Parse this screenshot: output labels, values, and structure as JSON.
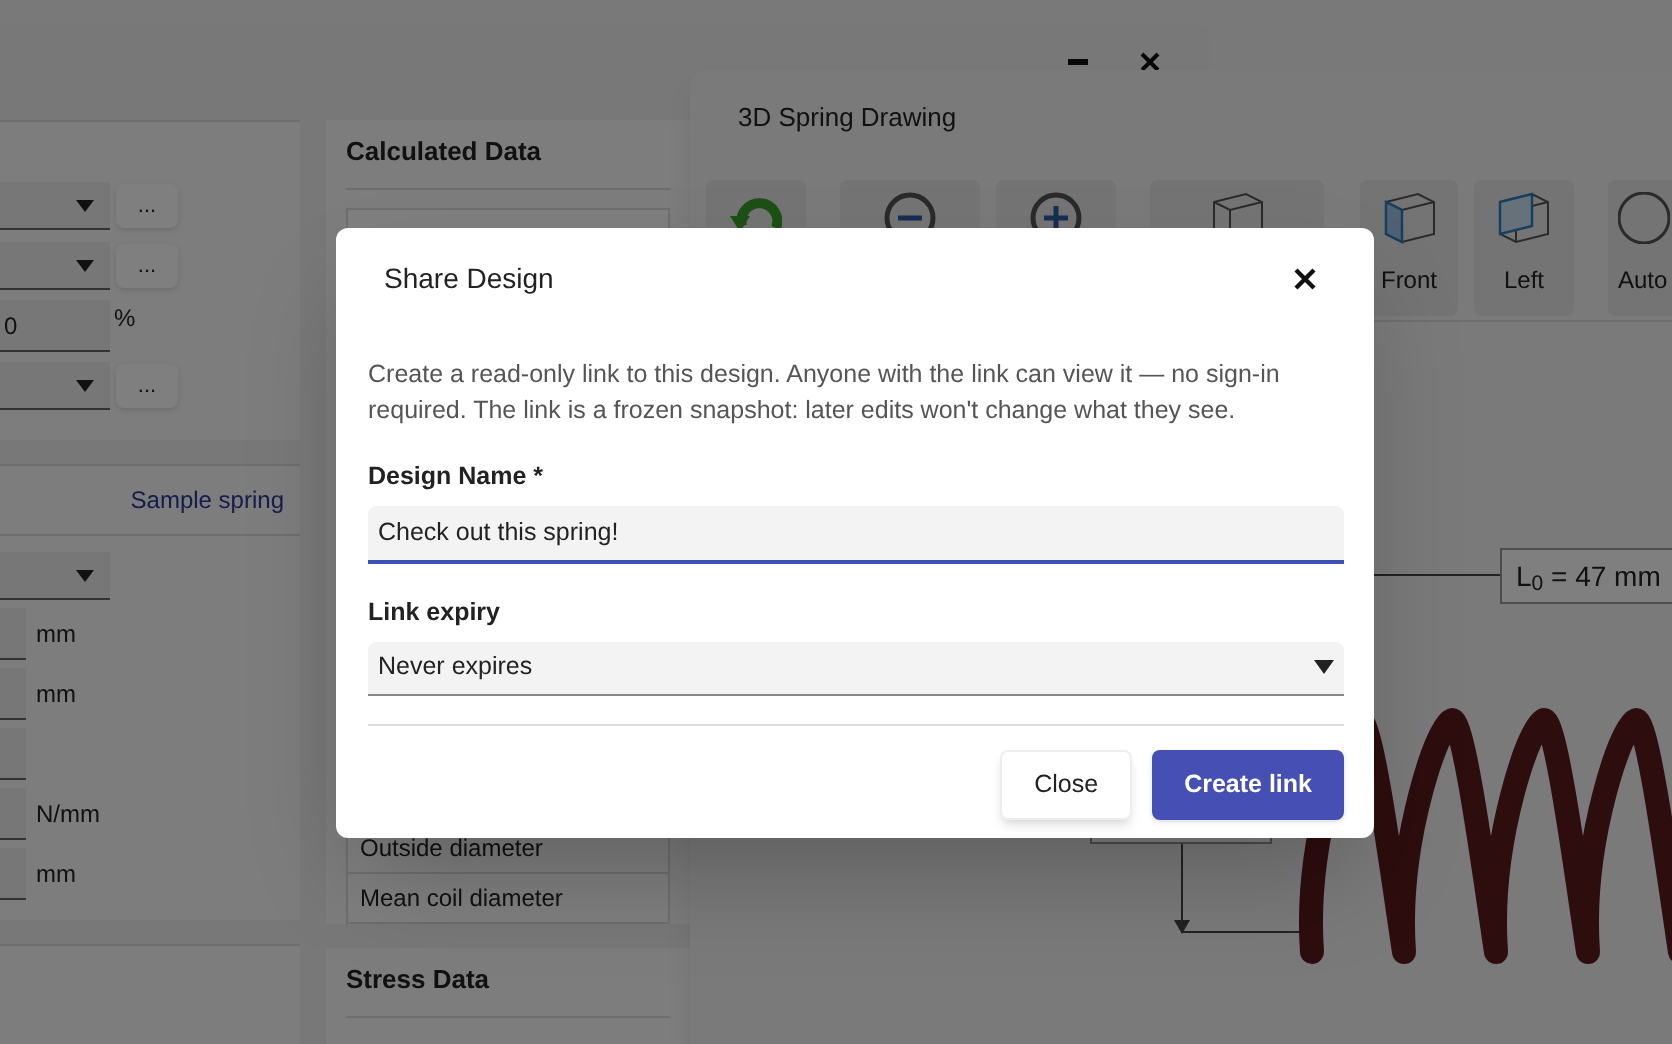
{
  "main_window": {
    "left_panel": {
      "rows": [
        {
          "kind": "dropdown",
          "button": "..."
        },
        {
          "kind": "dropdown",
          "button": "..."
        },
        {
          "kind": "number",
          "value": "0",
          "unit": "%"
        },
        {
          "kind": "dropdown",
          "button": "..."
        }
      ]
    },
    "spring_panel": {
      "link": "Sample spring",
      "rows": [
        {
          "kind": "dropdown"
        },
        {
          "kind": "number",
          "unit": "mm"
        },
        {
          "kind": "number",
          "unit": "mm"
        },
        {
          "kind": "number"
        },
        {
          "kind": "number",
          "unit": "N/mm"
        },
        {
          "kind": "number",
          "unit": "mm"
        }
      ]
    },
    "calculated_data": {
      "title": "Calculated Data",
      "rows": [
        "Outside diameter",
        "Mean coil diameter"
      ]
    },
    "stress_data": {
      "title": "Stress Data"
    }
  },
  "drawing_window": {
    "title": "3D Spring Drawing",
    "toolbar": [
      {
        "kind": "refresh"
      },
      {
        "kind": "zoom_out"
      },
      {
        "kind": "zoom_in"
      },
      {
        "kind": "iso"
      },
      {
        "kind": "front",
        "label": "Front"
      },
      {
        "kind": "left",
        "label": "Left"
      },
      {
        "kind": "auto",
        "label": "Auto"
      }
    ],
    "dimension": "L$_{0}$ = 47 mm"
  },
  "dialog": {
    "title": "Share Design",
    "description": "Create a read-only link to this design. Anyone with the link can view it — no sign-in required. The link is a frozen snapshot: later edits won't change what they see.",
    "name_label": "Design Name *",
    "name_value": "Check out this spring!",
    "expiry_label": "Link expiry",
    "expiry_value": "Never expires",
    "buttons": [
      {
        "kind": "secondary",
        "label": "Close"
      },
      {
        "kind": "primary",
        "label": "Create link"
      }
    ]
  }
}
